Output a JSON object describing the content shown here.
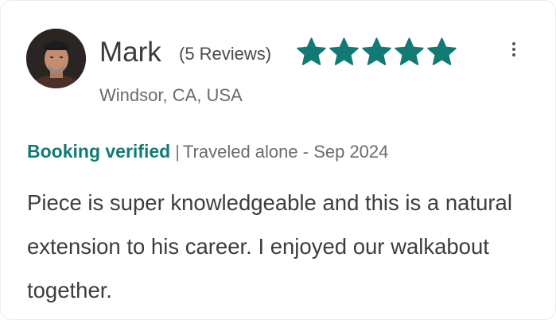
{
  "review": {
    "reviewer_name": "Mark",
    "review_count": "(5 Reviews)",
    "location": "Windsor, CA, USA",
    "rating": 5,
    "max_rating": 5,
    "star_color": "#127a74",
    "verified_label": "Booking verified",
    "separator": "|",
    "travel_info": "Traveled alone - Sep 2024",
    "text": "Piece is super knowledgeable and this is a natural extension to his career. I enjoyed our walkabout together."
  },
  "icons": {
    "avatar": "reviewer-avatar-photo",
    "menu": "more-vertical-icon",
    "star": "star-icon"
  }
}
